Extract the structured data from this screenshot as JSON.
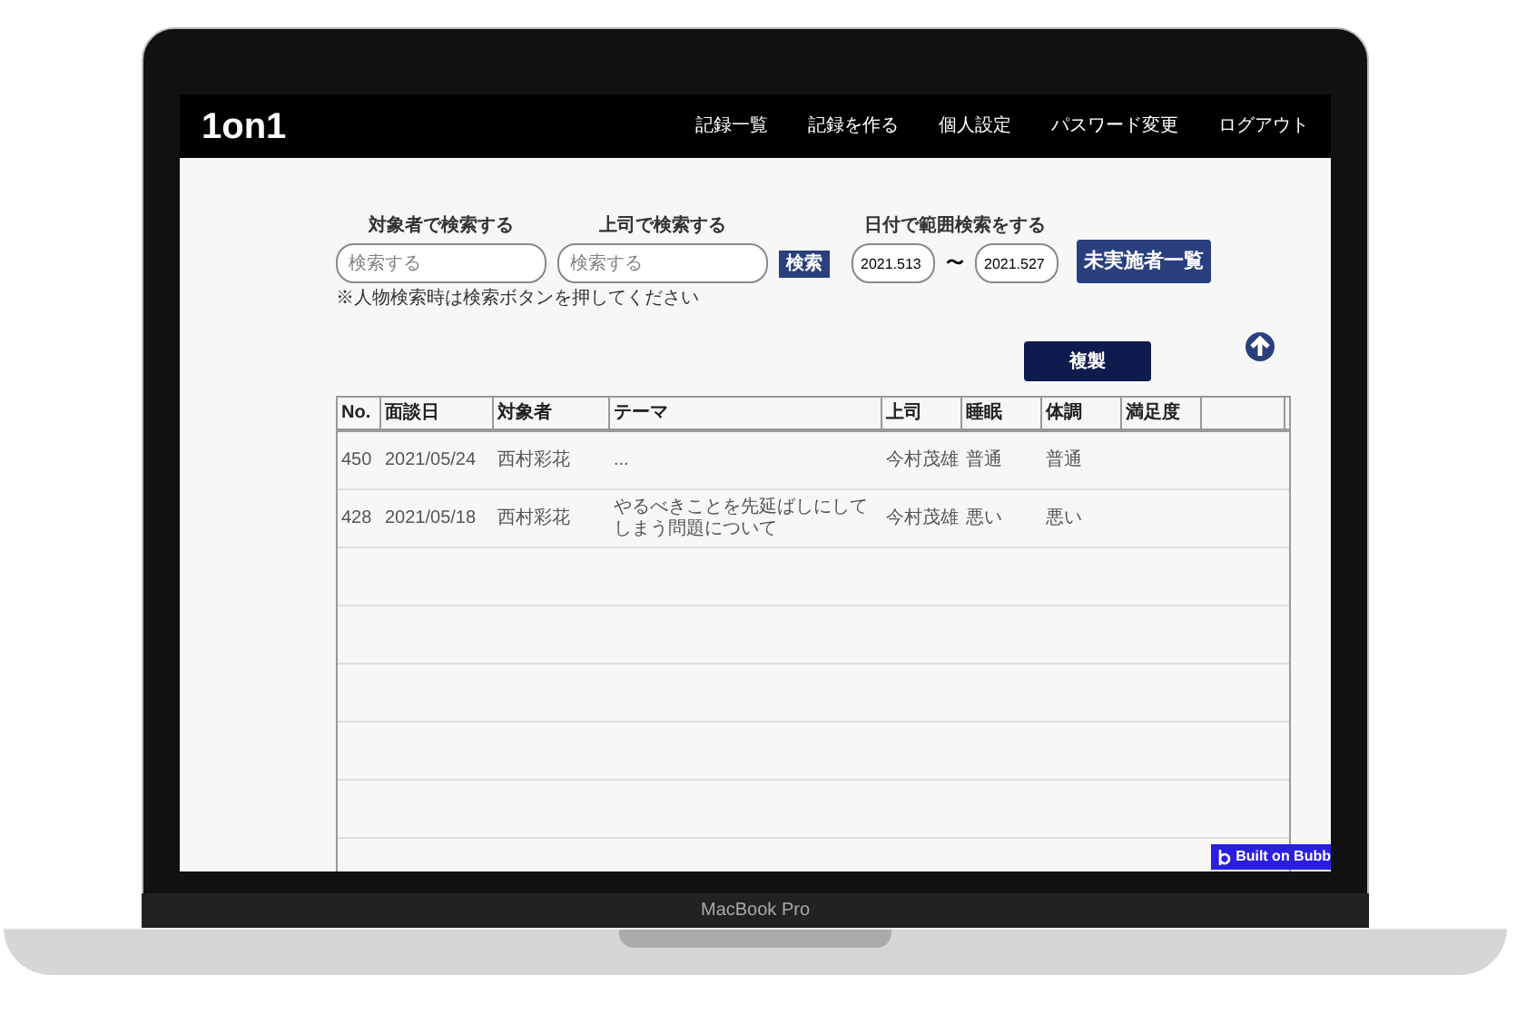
{
  "laptop": {
    "model": "MacBook Pro"
  },
  "nav": {
    "logo": "1on1",
    "items": [
      "記録一覧",
      "記録を作る",
      "個人設定",
      "パスワード変更",
      "ログアウト"
    ]
  },
  "search": {
    "target": {
      "label": "対象者で検索する",
      "placeholder": "検索する"
    },
    "boss": {
      "label": "上司で検索する",
      "placeholder": "検索する"
    },
    "search_button": "検索",
    "date_label": "日付で範囲検索をする",
    "date_from": "2021.513",
    "tilde": "〜",
    "date_to": "2021.527",
    "pending_button": "未実施者一覧",
    "note": "※人物検索時は検索ボタンを押してください"
  },
  "copy_button": "複製",
  "table": {
    "columns": [
      "No.",
      "面談日",
      "対象者",
      "テーマ",
      "上司",
      "睡眠",
      "体調",
      "満足度"
    ],
    "rows": [
      [
        "450",
        "2021/05/24",
        "西村彩花",
        "...",
        "今村茂雄",
        "普通",
        "普通",
        ""
      ],
      [
        "428",
        "2021/05/18",
        "西村彩花",
        "やるべきことを先延ばしにしてしまう問題について",
        "今村茂雄",
        "悪い",
        "悪い",
        ""
      ]
    ]
  },
  "badge": "Built on Bubb"
}
